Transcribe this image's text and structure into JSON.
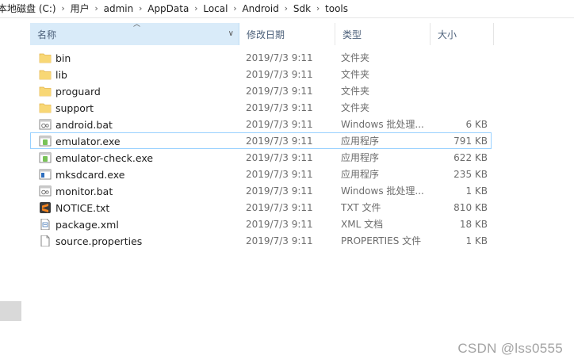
{
  "breadcrumb": [
    "本地磁盘 (C:)",
    "用户",
    "admin",
    "AppData",
    "Local",
    "Android",
    "Sdk",
    "tools"
  ],
  "columns": {
    "name": "名称",
    "date": "修改日期",
    "type": "类型",
    "size": "大小"
  },
  "files": [
    {
      "name": "bin",
      "date": "2019/7/3 9:11",
      "type": "文件夹",
      "size": "",
      "icon": "folder-icon"
    },
    {
      "name": "lib",
      "date": "2019/7/3 9:11",
      "type": "文件夹",
      "size": "",
      "icon": "folder-icon"
    },
    {
      "name": "proguard",
      "date": "2019/7/3 9:11",
      "type": "文件夹",
      "size": "",
      "icon": "folder-icon"
    },
    {
      "name": "support",
      "date": "2019/7/3 9:11",
      "type": "文件夹",
      "size": "",
      "icon": "folder-icon"
    },
    {
      "name": "android.bat",
      "date": "2019/7/3 9:11",
      "type": "Windows 批处理...",
      "size": "6 KB",
      "icon": "batch-file-icon"
    },
    {
      "name": "emulator.exe",
      "date": "2019/7/3 9:11",
      "type": "应用程序",
      "size": "791 KB",
      "icon": "android-exe-icon"
    },
    {
      "name": "emulator-check.exe",
      "date": "2019/7/3 9:11",
      "type": "应用程序",
      "size": "622 KB",
      "icon": "android-exe-icon"
    },
    {
      "name": "mksdcard.exe",
      "date": "2019/7/3 9:11",
      "type": "应用程序",
      "size": "235 KB",
      "icon": "exe-icon"
    },
    {
      "name": "monitor.bat",
      "date": "2019/7/3 9:11",
      "type": "Windows 批处理...",
      "size": "1 KB",
      "icon": "batch-file-icon"
    },
    {
      "name": "NOTICE.txt",
      "date": "2019/7/3 9:11",
      "type": "TXT 文件",
      "size": "810 KB",
      "icon": "sublime-text-icon"
    },
    {
      "name": "package.xml",
      "date": "2019/7/3 9:11",
      "type": "XML 文档",
      "size": "18 KB",
      "icon": "xml-file-icon"
    },
    {
      "name": "source.properties",
      "date": "2019/7/3 9:11",
      "type": "PROPERTIES 文件",
      "size": "1 KB",
      "icon": "blank-file-icon"
    }
  ],
  "selected_index": 5,
  "watermark": "CSDN @lss0555",
  "colors": {
    "header_active": "#d9ebf9",
    "selection_border": "#99d1ff",
    "folder": "#f8d775",
    "folder_dark": "#e3b44b",
    "android_green": "#78c257",
    "sublime_orange": "#f4841f"
  }
}
